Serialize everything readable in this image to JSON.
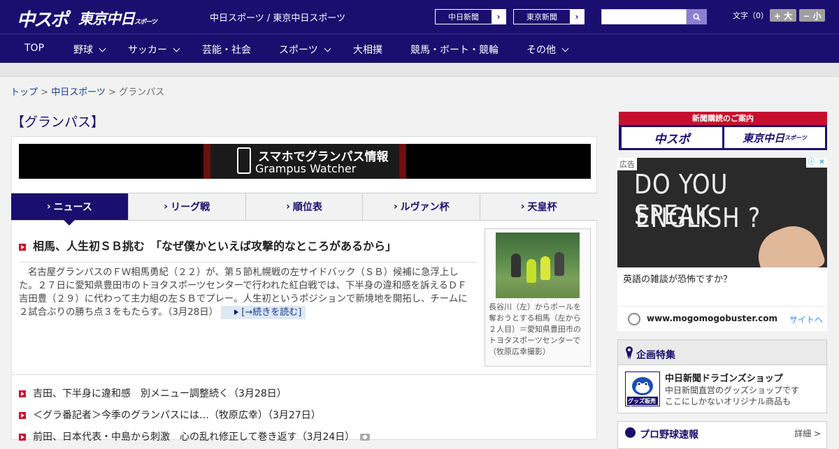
{
  "header": {
    "logo_chu": "中スポ",
    "logo_tokyo": "東京中日",
    "logo_tokyo_sub": "スポーツ",
    "site_names": "中日スポーツ / 東京中日スポーツ",
    "paper_links": [
      {
        "label": "中日新聞",
        "arrow": "›"
      },
      {
        "label": "東京新聞",
        "arrow": "›"
      }
    ],
    "search_placeholder": "",
    "font_size_label": "文字（0）",
    "font_bigger": "+ 大",
    "font_smaller": "− 小"
  },
  "nav": [
    {
      "label": "TOP",
      "has_dropdown": false
    },
    {
      "label": "野球",
      "has_dropdown": true
    },
    {
      "label": "サッカー",
      "has_dropdown": true
    },
    {
      "label": "芸能・社会",
      "has_dropdown": false
    },
    {
      "label": "スポーツ",
      "has_dropdown": true
    },
    {
      "label": "大相撲",
      "has_dropdown": false
    },
    {
      "label": "競馬・ボート・競輪",
      "has_dropdown": false
    },
    {
      "label": "その他",
      "has_dropdown": true
    }
  ],
  "breadcrumb": {
    "top": "トップ",
    "sep": ">",
    "section": "中日スポーツ",
    "current": "グランパス"
  },
  "page_title": "【グランパス】",
  "banner": {
    "line1": "スマホでグランパス情報",
    "line2": "Grampus Watcher"
  },
  "tabs": [
    {
      "label": "ニュース",
      "active": true
    },
    {
      "label": "リーグ戦",
      "active": false
    },
    {
      "label": "順位表",
      "active": false
    },
    {
      "label": "ルヴァン杯",
      "active": false
    },
    {
      "label": "天皇杯",
      "active": false
    }
  ],
  "lead_article": {
    "title": "相馬、人生初ＳＢ挑む　「なぜ僕かといえば攻撃的なところがあるから」",
    "body": "名古屋グランパスのＦＷ相馬勇紀（２２）が、第５節札幌戦の左サイドバック（ＳＢ）候補に急浮上した。２７日に愛知県豊田市のトヨタスポーツセンターで行われた紅白戦では、下半身の違和感を訴えるＤＦ吉田豊（２９）に代わって主力組の左ＳＢでプレー。人生初というポジションで新境地を開拓し、チームに２試合ぶりの勝ち点３をもたらす。（3月28日）",
    "read_more": "[→続きを読む]",
    "photo_caption": "長谷川（左）からボールを奪おうとする相馬（左から２人目）＝愛知県豊田市のトヨタスポーツセンターで（牧原広幸撮影）"
  },
  "news_list": [
    {
      "text": "吉田、下半身に違和感　別メニュー調整続く（3月28日）",
      "has_photo": false
    },
    {
      "text": "＜グラ番記者＞今季のグランパスには…（牧原広幸）（3月27日）",
      "has_photo": false
    },
    {
      "text": "前田、日本代表・中島から刺激　心の乱れ修正して巻き返す（3月24日）",
      "has_photo": true
    }
  ],
  "sidebar": {
    "subscription_head": "新聞購読のご案内",
    "sub_logo_1": "中スポ",
    "sub_logo_2": "東京中日",
    "sub_logo_2_small": "スポーツ",
    "ad": {
      "label": "広告",
      "chalk_line1": "DO YOU SPEAK",
      "chalk_line2": "ENGLISH ?",
      "text": "英語の雑談が恐怖ですか？",
      "url": "www.mogomogobuster.com",
      "site_link": "サイトへ"
    },
    "feature": {
      "title": "企画特集",
      "shop_name": "中日新聞ドラゴンズショップ",
      "shop_desc_1": "中日新聞直営のグッズショップです",
      "shop_desc_2": "ここにしかないオリジナル商品も",
      "shop_img_label": "グッズ販売中"
    },
    "baseball": {
      "title": "プロ野球速報",
      "detail": "詳細 >"
    }
  },
  "colors": {
    "brand_navy": "#1a0f6e",
    "accent_red": "#c8102e",
    "link_blue": "#1a3c8e"
  }
}
